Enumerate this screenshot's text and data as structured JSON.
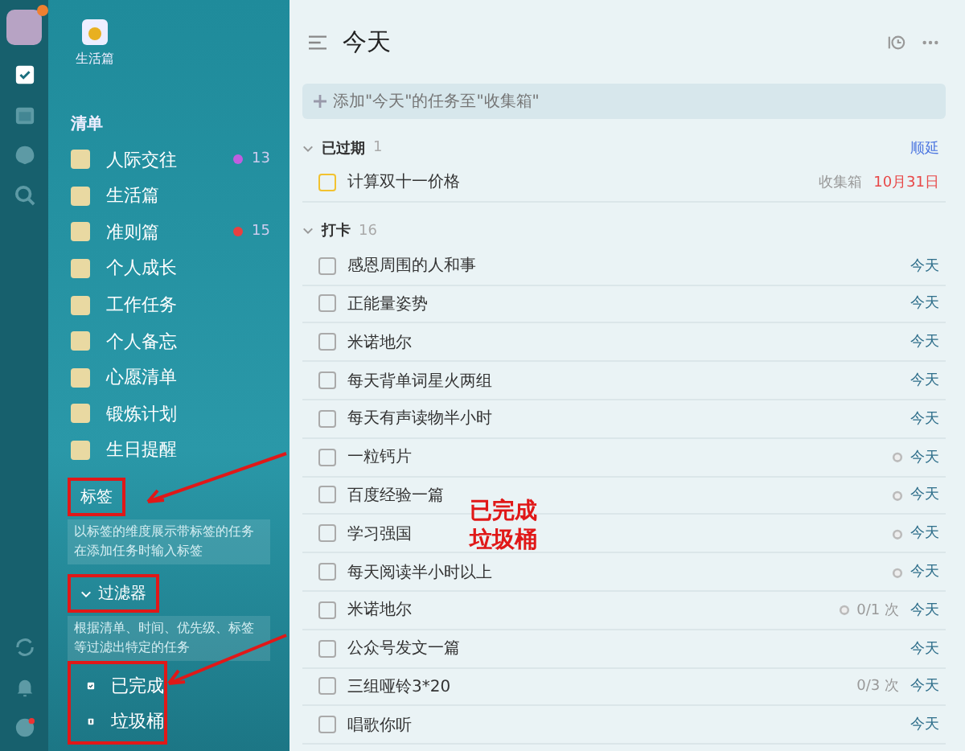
{
  "rail": {
    "top": [
      {
        "kind": "check",
        "selected": true
      },
      {
        "kind": "calendar",
        "selected": false
      },
      {
        "kind": "clock",
        "selected": false
      },
      {
        "kind": "search",
        "selected": false
      }
    ],
    "bottom": [
      {
        "kind": "sync"
      },
      {
        "kind": "bell"
      },
      {
        "kind": "help"
      }
    ]
  },
  "sidebar": {
    "pinned": {
      "label": "生活篇"
    },
    "list_header": "清单",
    "lists": [
      {
        "label": "人际交往",
        "color": "#c05ee0",
        "count": "13"
      },
      {
        "label": "生活篇"
      },
      {
        "label": "准则篇",
        "color": "#e84040",
        "count": "15"
      },
      {
        "label": "个人成长"
      },
      {
        "label": "工作任务"
      },
      {
        "label": "个人备忘"
      },
      {
        "label": "心愿清单"
      },
      {
        "label": "锻炼计划"
      },
      {
        "label": "生日提醒"
      }
    ],
    "sections": [
      {
        "title": "标签",
        "annotated": true,
        "expanded": false,
        "description": "以标签的维度展示带标签的任务在添加任务时输入标签"
      },
      {
        "title": "过滤器",
        "annotated": true,
        "expanded": true,
        "description": "根据清单、时间、优先级、标签等过滤出特定的任务"
      }
    ],
    "bottom": [
      {
        "label": "已完成",
        "kind": "done"
      },
      {
        "label": "垃圾桶",
        "kind": "trash"
      }
    ],
    "bottom_annotated": true
  },
  "annotation": {
    "lines": [
      "已完成",
      "垃圾桶"
    ]
  },
  "main": {
    "title": "今天",
    "placeholder": "添加\"今天\"的任务至\"收集箱\"",
    "groups": [
      {
        "title": "已过期",
        "count": "1",
        "action": "顺延",
        "tasks": [
          {
            "title": "计算双十一价格",
            "checked": false,
            "color": "#f2c230",
            "list": "收集箱",
            "date": "10月31日",
            "overdue": true
          }
        ]
      },
      {
        "title": "打卡",
        "count": "16",
        "tasks": [
          {
            "title": "感恩周围的人和事",
            "checked": false,
            "date": "今天"
          },
          {
            "title": "正能量姿势",
            "checked": false,
            "date": "今天"
          },
          {
            "title": "米诺地尔",
            "checked": false,
            "date": "今天"
          },
          {
            "title": "每天背单词星火两组",
            "checked": false,
            "date": "今天"
          },
          {
            "title": "每天有声读物半小时",
            "checked": false,
            "date": "今天"
          },
          {
            "title": "一粒钙片",
            "checked": false,
            "alarm": true,
            "date": "今天"
          },
          {
            "title": "百度经验一篇",
            "checked": false,
            "alarm": true,
            "date": "今天"
          },
          {
            "title": "学习强国",
            "checked": false,
            "alarm": true,
            "date": "今天"
          },
          {
            "title": "每天阅读半小时以上",
            "checked": false,
            "alarm": true,
            "date": "今天"
          },
          {
            "title": "米诺地尔",
            "checked": false,
            "alarm": true,
            "tally": "0/1 次",
            "date": "今天"
          },
          {
            "title": "公众号发文一篇",
            "checked": false,
            "date": "今天"
          },
          {
            "title": "三组哑铃3*20",
            "checked": false,
            "tally": "0/3 次",
            "date": "今天"
          },
          {
            "title": "唱歌你听",
            "checked": false,
            "date": "今天"
          }
        ]
      }
    ]
  }
}
